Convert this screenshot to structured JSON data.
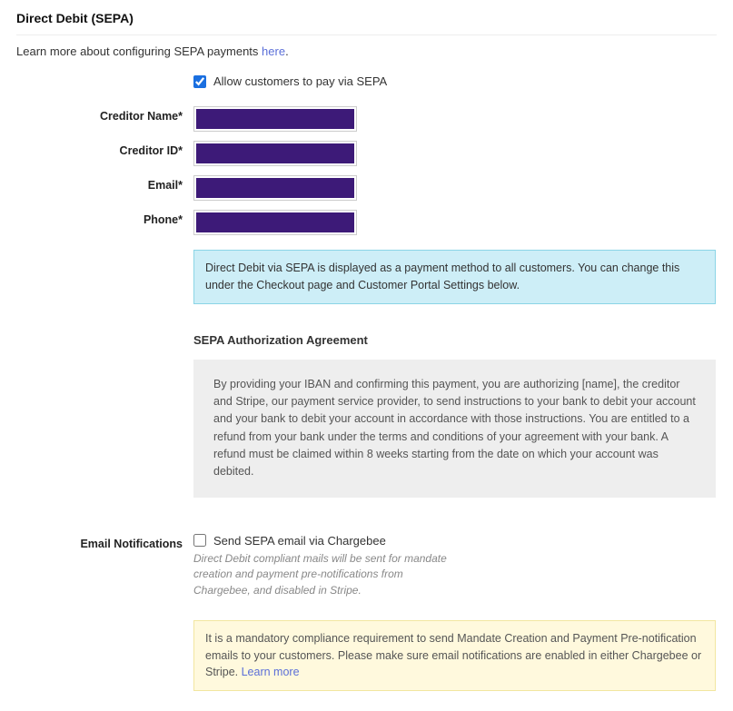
{
  "header": {
    "title": "Direct Debit (SEPA)",
    "learn_more_prefix": "Learn more about configuring SEPA payments ",
    "learn_more_link": "here",
    "learn_more_suffix": "."
  },
  "allow_sepa": {
    "label": "Allow customers to pay via SEPA",
    "checked": true
  },
  "fields": {
    "creditor_name_label": "Creditor Name*",
    "creditor_id_label": "Creditor ID*",
    "email_label": "Email*",
    "phone_label": "Phone*"
  },
  "info_box_text": "Direct Debit via SEPA is displayed as a payment method to all customers. You can change this under the Checkout page and Customer Portal Settings below.",
  "agreement": {
    "heading": "SEPA Authorization Agreement",
    "body": "By providing your IBAN and confirming this payment, you are authorizing [name], the creditor and Stripe, our payment service provider, to send instructions to your bank to debit your account and your bank to debit your account in accordance with those instructions. You are entitled to a refund from your bank under the terms and conditions of your agreement with your bank. A refund must be claimed within 8 weeks starting from the date on which your account was debited."
  },
  "email_notifications": {
    "section_label": "Email Notifications",
    "checkbox_label": "Send SEPA email via Chargebee",
    "checked": false,
    "help_text": "Direct Debit compliant mails will be sent for mandate creation and payment pre-notifications from Chargebee, and disabled in Stripe."
  },
  "warning": {
    "text": "It is a mandatory compliance requirement to send Mandate Creation and Payment Pre-notification emails to your customers. Please make sure email notifications are enabled in either Chargebee or Stripe. ",
    "link_text": "Learn more"
  }
}
